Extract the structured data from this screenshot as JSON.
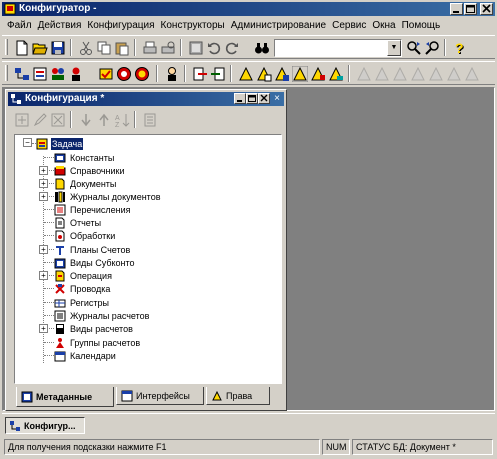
{
  "window": {
    "title": "Конфигуратор -"
  },
  "menu": [
    "Файл",
    "Действия",
    "Конфигурация",
    "Конструкторы",
    "Администрирование",
    "Сервис",
    "Окна",
    "Помощь"
  ],
  "toolbar": {
    "search_value": ""
  },
  "config_window": {
    "title": "Конфигурация *",
    "root": "Задача",
    "items": [
      "Константы",
      "Справочники",
      "Документы",
      "Журналы документов",
      "Перечисления",
      "Отчеты",
      "Обработки",
      "Планы Счетов",
      "Виды Субконто",
      "Операция",
      "Проводка",
      "Регистры",
      "Журналы расчетов",
      "Виды расчетов",
      "Группы расчетов",
      "Календари"
    ],
    "tabs": [
      "Метаданные",
      "Интерфейсы",
      "Права"
    ]
  },
  "taskbar": {
    "item": "Конфигур..."
  },
  "status": {
    "hint": "Для получения подсказки нажмите F1",
    "num": "NUM",
    "right": "СТАТУС БД: Документ *"
  }
}
